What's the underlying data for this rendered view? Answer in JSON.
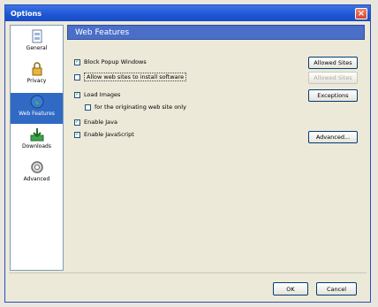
{
  "window": {
    "title": "Options",
    "close_glyph": "×"
  },
  "sidebar": {
    "items": [
      {
        "label": "General",
        "icon": "general-icon",
        "selected": false
      },
      {
        "label": "Privacy",
        "icon": "lock-icon",
        "selected": false
      },
      {
        "label": "Web Features",
        "icon": "globe-icon",
        "selected": true
      },
      {
        "label": "Downloads",
        "icon": "downloads-icon",
        "selected": false
      },
      {
        "label": "Advanced",
        "icon": "gear-icon",
        "selected": false
      }
    ]
  },
  "panel": {
    "header": "Web Features",
    "options": [
      {
        "label": "Block Popup Windows",
        "checked": true
      },
      {
        "label": "Allow web sites to install software",
        "checked": false
      },
      {
        "label": "Load Images",
        "checked": true
      },
      {
        "label": "for the originating web site only",
        "checked": false
      },
      {
        "label": "Enable Java",
        "checked": true
      },
      {
        "label": "Enable JavaScript",
        "checked": true
      }
    ],
    "buttons": {
      "allowed_sites": "Allowed Sites",
      "allowed_sites_2": "Allowed Sites",
      "exceptions": "Exceptions",
      "advanced": "Advanced..."
    }
  },
  "footer": {
    "ok": "OK",
    "cancel": "Cancel"
  },
  "colors": {
    "accent": "#316ac5",
    "header": "#4b6fc8",
    "titlebar": "#1d55d4"
  }
}
